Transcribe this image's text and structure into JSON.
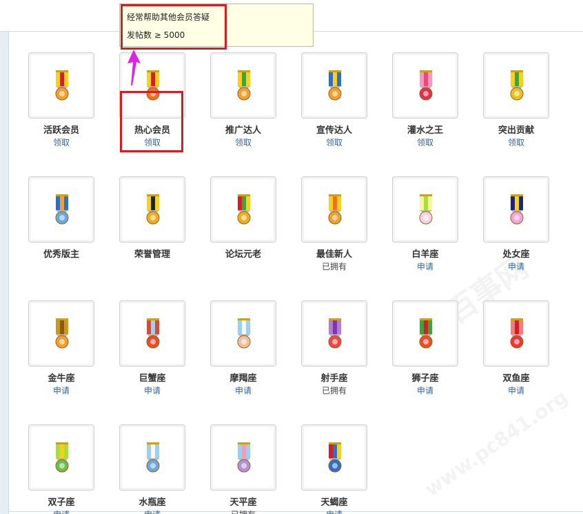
{
  "tooltip": {
    "line1": "经常帮助其他会员答疑",
    "line2": "发帖数 ≥ 5000"
  },
  "watermark": {
    "cn": "电脑百事网",
    "url": "www.pc841.org"
  },
  "medals": [
    {
      "name": "活跃会员",
      "action": "领取",
      "icon": "medal-ribbon-red-orange-icon",
      "ribbon": [
        "#f7d21c",
        "#d31f2a",
        "#f7d21c"
      ],
      "disc": "#f0a030"
    },
    {
      "name": "热心会员",
      "action": "领取",
      "icon": "medal-ribbon-yellow-red-icon",
      "ribbon": [
        "#f7d21c",
        "#d31f2a",
        "#f7d21c"
      ],
      "disc": "#f36f21"
    },
    {
      "name": "推广达人",
      "action": "领取",
      "icon": "medal-ribbon-yellow-green-icon",
      "ribbon": [
        "#f7d21c",
        "#3aa53a",
        "#f7d21c"
      ],
      "disc": "#f0a030"
    },
    {
      "name": "宣传达人",
      "action": "领取",
      "icon": "medal-ribbon-blue-yellow-icon",
      "ribbon": [
        "#2e6fc7",
        "#f7d21c",
        "#2e6fc7"
      ],
      "disc": "#f0a030"
    },
    {
      "name": "灌水之王",
      "action": "领取",
      "icon": "medal-ribbon-pink-icon",
      "ribbon": [
        "#f59abb",
        "#e84a7f",
        "#f59abb"
      ],
      "disc": "#e03050"
    },
    {
      "name": "突出贡献",
      "action": "领取",
      "icon": "medal-ribbon-star-green-icon",
      "ribbon": [
        "#f7d21c",
        "#3aa53a",
        "#f7d21c"
      ],
      "disc": "#e8c020"
    },
    {
      "name": "优秀版主",
      "action": "",
      "icon": "medal-ribbon-blue-orange-icon",
      "ribbon": [
        "#2e6fc7",
        "#f0a030",
        "#2e6fc7"
      ],
      "disc": "#6aa8e0"
    },
    {
      "name": "荣誉管理",
      "action": "",
      "icon": "medal-ribbon-black-yellow-icon",
      "ribbon": [
        "#f7d21c",
        "#222222",
        "#f7d21c"
      ],
      "disc": "#e8b020"
    },
    {
      "name": "论坛元老",
      "action": "",
      "icon": "medal-ribbon-red-green-icon",
      "ribbon": [
        "#d31f2a",
        "#3aa53a",
        "#f7d21c"
      ],
      "disc": "#e8b020"
    },
    {
      "name": "最佳新人",
      "action": "已拥有",
      "icon": "medal-ribbon-yellow-orange-icon",
      "ribbon": [
        "#f7d21c",
        "#f36f21",
        "#f7d21c"
      ],
      "disc": "#f0a030"
    },
    {
      "name": "白羊座",
      "action": "申请",
      "icon": "aries-medal-icon",
      "ribbon": [
        "#f7f7a0",
        "#a6e03a",
        "#f7f7a0"
      ],
      "disc": "#f2d4e8"
    },
    {
      "name": "处女座",
      "action": "申请",
      "icon": "virgo-medal-icon",
      "ribbon": [
        "#20237a",
        "#f7d21c",
        "#20237a"
      ],
      "disc": "#f2a6d8"
    },
    {
      "name": "金牛座",
      "action": "申请",
      "icon": "taurus-medal-icon",
      "ribbon": [
        "#c89a20",
        "#8a5a10",
        "#c89a20"
      ],
      "disc": "#f0a030"
    },
    {
      "name": "巨蟹座",
      "action": "申请",
      "icon": "cancer-medal-icon",
      "ribbon": [
        "#d64a3a",
        "#9ad0f0",
        "#d64a3a"
      ],
      "disc": "#e0502a"
    },
    {
      "name": "摩羯座",
      "action": "申请",
      "icon": "capricorn-medal-icon",
      "ribbon": [
        "#9ad0f0",
        "#f7f7f7",
        "#9ad0f0"
      ],
      "disc": "#f0c0a0"
    },
    {
      "name": "射手座",
      "action": "已拥有",
      "icon": "sagittarius-medal-icon",
      "ribbon": [
        "#b77ad8",
        "#7a3aa8",
        "#b77ad8"
      ],
      "disc": "#e84a4a"
    },
    {
      "name": "狮子座",
      "action": "申请",
      "icon": "leo-medal-icon",
      "ribbon": [
        "#3aa53a",
        "#d31f2a",
        "#3aa53a"
      ],
      "disc": "#e8502a"
    },
    {
      "name": "双鱼座",
      "action": "申请",
      "icon": "pisces-medal-icon",
      "ribbon": [
        "#f08080",
        "#d31f2a",
        "#f08080"
      ],
      "disc": "#e83a3a"
    },
    {
      "name": "双子座",
      "action": "申请",
      "icon": "gemini-medal-icon",
      "ribbon": [
        "#a6e03a",
        "#f7d21c",
        "#a6e03a"
      ],
      "disc": "#6ac04a"
    },
    {
      "name": "水瓶座",
      "action": "申请",
      "icon": "aquarius-medal-icon",
      "ribbon": [
        "#9ad0f0",
        "#f7f7f7",
        "#9ad0f0"
      ],
      "disc": "#6aa8e0"
    },
    {
      "name": "天平座",
      "action": "已拥有",
      "icon": "libra-medal-icon",
      "ribbon": [
        "#9ad0f0",
        "#f59abb",
        "#9ad0f0"
      ],
      "disc": "#b090d8"
    },
    {
      "name": "天蝎座",
      "action": "申请",
      "icon": "scorpio-medal-icon",
      "ribbon": [
        "#d31f2a",
        "#2e6fc7",
        "#f7d21c"
      ],
      "disc": "#2e6fc7"
    }
  ]
}
